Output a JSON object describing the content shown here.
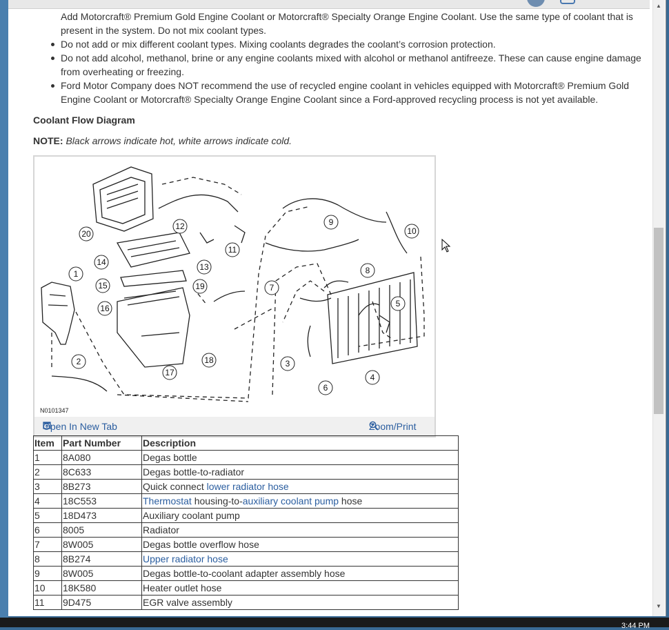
{
  "intro_partial": "Add Motorcraft® Premium Gold Engine Coolant or Motorcraft® Specialty Orange Engine Coolant. Use the same type of coolant that is present in the system. Do not mix coolant types.",
  "bullets": [
    "Do not add or mix different coolant types. Mixing coolants degrades the coolant’s corrosion protection.",
    "Do not add alcohol, methanol, brine or any engine coolants mixed with alcohol or methanol antifreeze. These can cause engine damage from overheating or freezing.",
    "Ford Motor Company does NOT recommend the use of recycled engine coolant in vehicles equipped with Motorcraft® Premium Gold Engine Coolant or Motorcraft® Specialty Orange Engine Coolant since a Ford-approved recycling process is not yet available."
  ],
  "section_title": "Coolant Flow Diagram",
  "note": {
    "label": "NOTE:",
    "text": "Black arrows indicate hot, white arrows indicate cold."
  },
  "figure": {
    "id": "N0101347",
    "open_tab": "Open In New Tab",
    "zoom": "Zoom/Print",
    "callouts": [
      "1",
      "2",
      "3",
      "4",
      "5",
      "6",
      "7",
      "8",
      "9",
      "10",
      "11",
      "12",
      "13",
      "14",
      "15",
      "16",
      "17",
      "18",
      "19",
      "20"
    ]
  },
  "table": {
    "headers": [
      "Item",
      "Part Number",
      "Description"
    ],
    "rows": [
      {
        "item": "1",
        "part": "8A080",
        "pre": "Degas bottle",
        "l1": "",
        "mid": "",
        "l2": "",
        "post": ""
      },
      {
        "item": "2",
        "part": "8C633",
        "pre": "Degas bottle-to-radiator",
        "l1": "",
        "mid": "",
        "l2": "",
        "post": ""
      },
      {
        "item": "3",
        "part": "8B273",
        "pre": "Quick connect ",
        "l1": "lower radiator hose",
        "mid": "",
        "l2": "",
        "post": ""
      },
      {
        "item": "4",
        "part": "18C553",
        "pre": "",
        "l1": "Thermostat",
        "mid": " housing-to-",
        "l2": "auxiliary coolant pump",
        "post": " hose"
      },
      {
        "item": "5",
        "part": "18D473",
        "pre": "Auxiliary coolant pump",
        "l1": "",
        "mid": "",
        "l2": "",
        "post": ""
      },
      {
        "item": "6",
        "part": "8005",
        "pre": "Radiator",
        "l1": "",
        "mid": "",
        "l2": "",
        "post": ""
      },
      {
        "item": "7",
        "part": "8W005",
        "pre": "Degas bottle overflow hose",
        "l1": "",
        "mid": "",
        "l2": "",
        "post": ""
      },
      {
        "item": "8",
        "part": "8B274",
        "pre": "",
        "l1": "Upper radiator hose",
        "mid": "",
        "l2": "",
        "post": ""
      },
      {
        "item": "9",
        "part": "8W005",
        "pre": "Degas bottle-to-coolant adapter assembly hose",
        "l1": "",
        "mid": "",
        "l2": "",
        "post": ""
      },
      {
        "item": "10",
        "part": "18K580",
        "pre": "Heater outlet hose",
        "l1": "",
        "mid": "",
        "l2": "",
        "post": ""
      },
      {
        "item": "11",
        "part": "9D475",
        "pre": "EGR valve assembly",
        "l1": "",
        "mid": "",
        "l2": "",
        "post": ""
      }
    ]
  },
  "taskbar": {
    "clock": "3:44 PM"
  }
}
